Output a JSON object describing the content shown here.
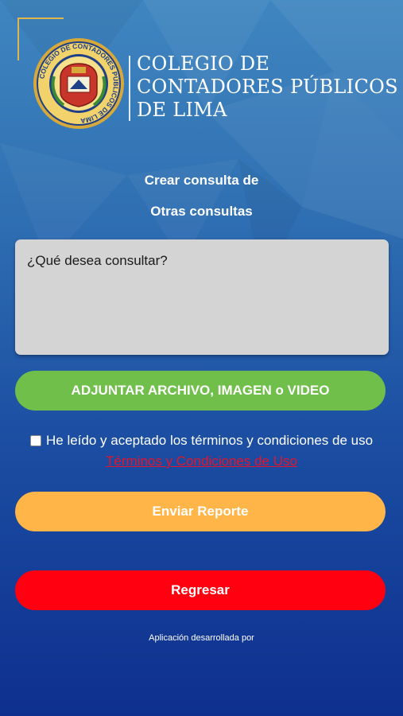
{
  "header": {
    "brand_lines": [
      "COLEGIO DE",
      "CONTADORES PÚBLICOS",
      "DE LIMA"
    ],
    "seal_text": "COLEGIO DE CONTADORES PÚBLICOS DE LIMA"
  },
  "form": {
    "title": "Crear consulta de",
    "category": "Otras consultas",
    "query_placeholder": "¿Qué desea consultar?",
    "query_value": "",
    "attach_label": "ADJUNTAR ARCHIVO, IMAGEN o VIDEO",
    "terms_label": "He leído y aceptado los términos y condiciones de uso",
    "terms_checked": false,
    "terms_link": "Términos y Condiciones de Uso",
    "send_label": "Enviar Reporte",
    "back_label": "Regresar"
  },
  "footer": {
    "credit": "Aplicación desarrollada por"
  },
  "colors": {
    "attach": "#6fbf4a",
    "send": "#ffb547",
    "back": "#ff0010",
    "link": "#e5142a",
    "gold": "#e0b64a"
  }
}
